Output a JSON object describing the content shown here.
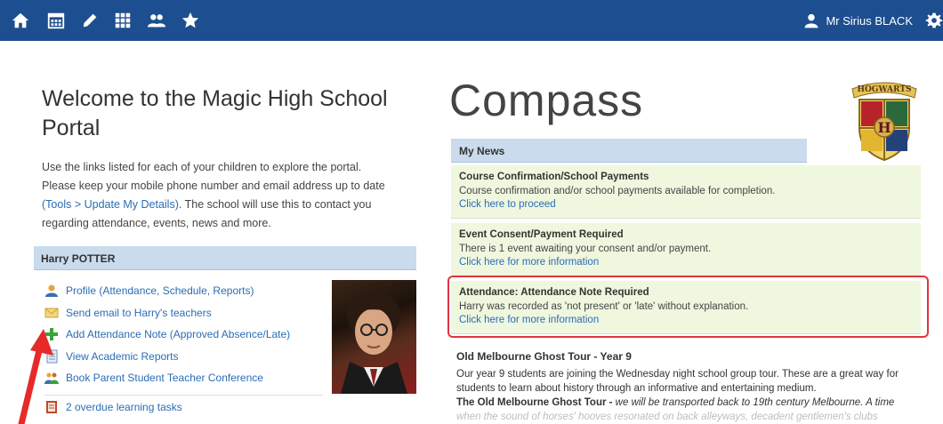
{
  "topbar": {
    "icons": [
      "home-icon",
      "calendar-icon",
      "pencil-icon",
      "grid-icon",
      "people-icon",
      "star-icon"
    ],
    "user_name": "Mr Sirius BLACK",
    "bg_color": "#1d4e8f"
  },
  "welcome": {
    "title": "Welcome to the Magic High School Portal",
    "line1": "Use the links listed for each of your children to explore the portal.",
    "line2": "Please keep your mobile phone number and email address up to date",
    "link_text": "(Tools > Update My Details)",
    "line3_rest": ". The school will use this to contact you",
    "line4": "regarding attendance, events, news and more."
  },
  "child": {
    "name": "Harry POTTER",
    "links": [
      {
        "label": "Profile (Attendance, Schedule, Reports)",
        "icon": "profile-icon"
      },
      {
        "label": "Send email to Harry's teachers",
        "icon": "email-icon"
      },
      {
        "label": "Add Attendance Note (Approved Absence/Late)",
        "icon": "add-icon"
      },
      {
        "label": "View Academic Reports",
        "icon": "report-icon"
      },
      {
        "label": "Book Parent Student Teacher Conference",
        "icon": "conference-icon"
      }
    ],
    "overdue": "2 overdue learning tasks"
  },
  "compass": {
    "title": "Compass",
    "crest_text": "HOGWARTS",
    "crest_letter": "H"
  },
  "news": {
    "header": "My News",
    "items": [
      {
        "title": "Course Confirmation/School Payments",
        "body": "Course confirmation and/or school payments available for completion.",
        "link": "Click here to proceed"
      },
      {
        "title": "Event Consent/Payment Required",
        "body": "There is 1 event awaiting your consent and/or payment.",
        "link": "Click here for more information"
      },
      {
        "title": "Attendance: Attendance Note Required",
        "body": "Harry was recorded as 'not present' or 'late' without explanation.",
        "link": "Click here for more information"
      }
    ],
    "highlight_color": "#e0343f"
  },
  "article": {
    "title": "Old Melbourne Ghost Tour - Year 9",
    "p1": "Our year 9 students are joining the Wednesday night school group tour. These are a great way for students to learn about history through an informative and entertaining medium.",
    "sub_title": "The Old Melbourne Ghost Tour - ",
    "sub_text": " we will be transported back to 19th century Melbourne. A time",
    "faded": "when the sound of horses' hooves resonated on back alleyways, decadent gentlemen's clubs"
  }
}
